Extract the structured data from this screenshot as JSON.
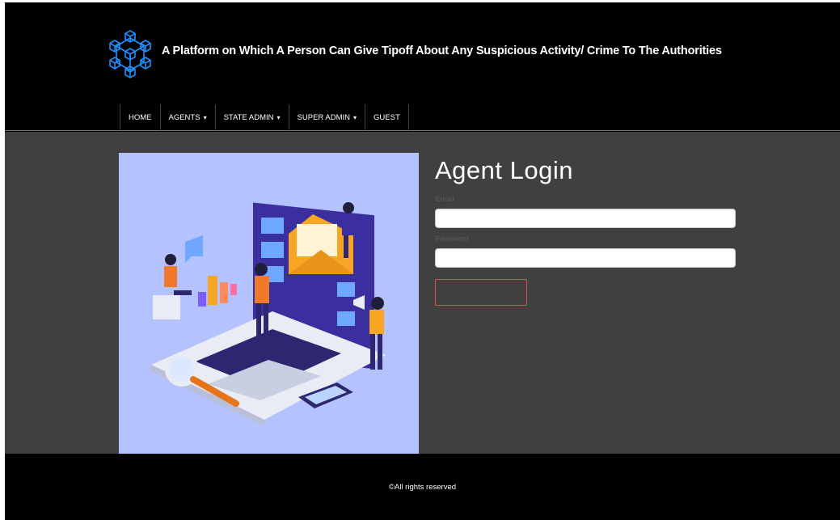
{
  "header": {
    "title": "A Platform on Which A Person Can Give Tipoff About Any Suspicious Activity/ Crime To The Authorities",
    "logo_icon": "cube-network-logo",
    "accent": "#1e90ff"
  },
  "nav": {
    "items": [
      {
        "label": "HOME",
        "dropdown": false
      },
      {
        "label": "AGENTS",
        "dropdown": true
      },
      {
        "label": "STATE ADMIN",
        "dropdown": true
      },
      {
        "label": "SUPER ADMIN",
        "dropdown": true
      },
      {
        "label": "GUEST",
        "dropdown": false
      }
    ],
    "caret": "▾"
  },
  "login": {
    "title": "Agent Login",
    "email_label": "Email",
    "email_value": "",
    "password_label": "Password",
    "password_value": "",
    "button_label": "",
    "button_color": "#d9534f"
  },
  "footer": {
    "copyright": "©All rights reserved"
  }
}
